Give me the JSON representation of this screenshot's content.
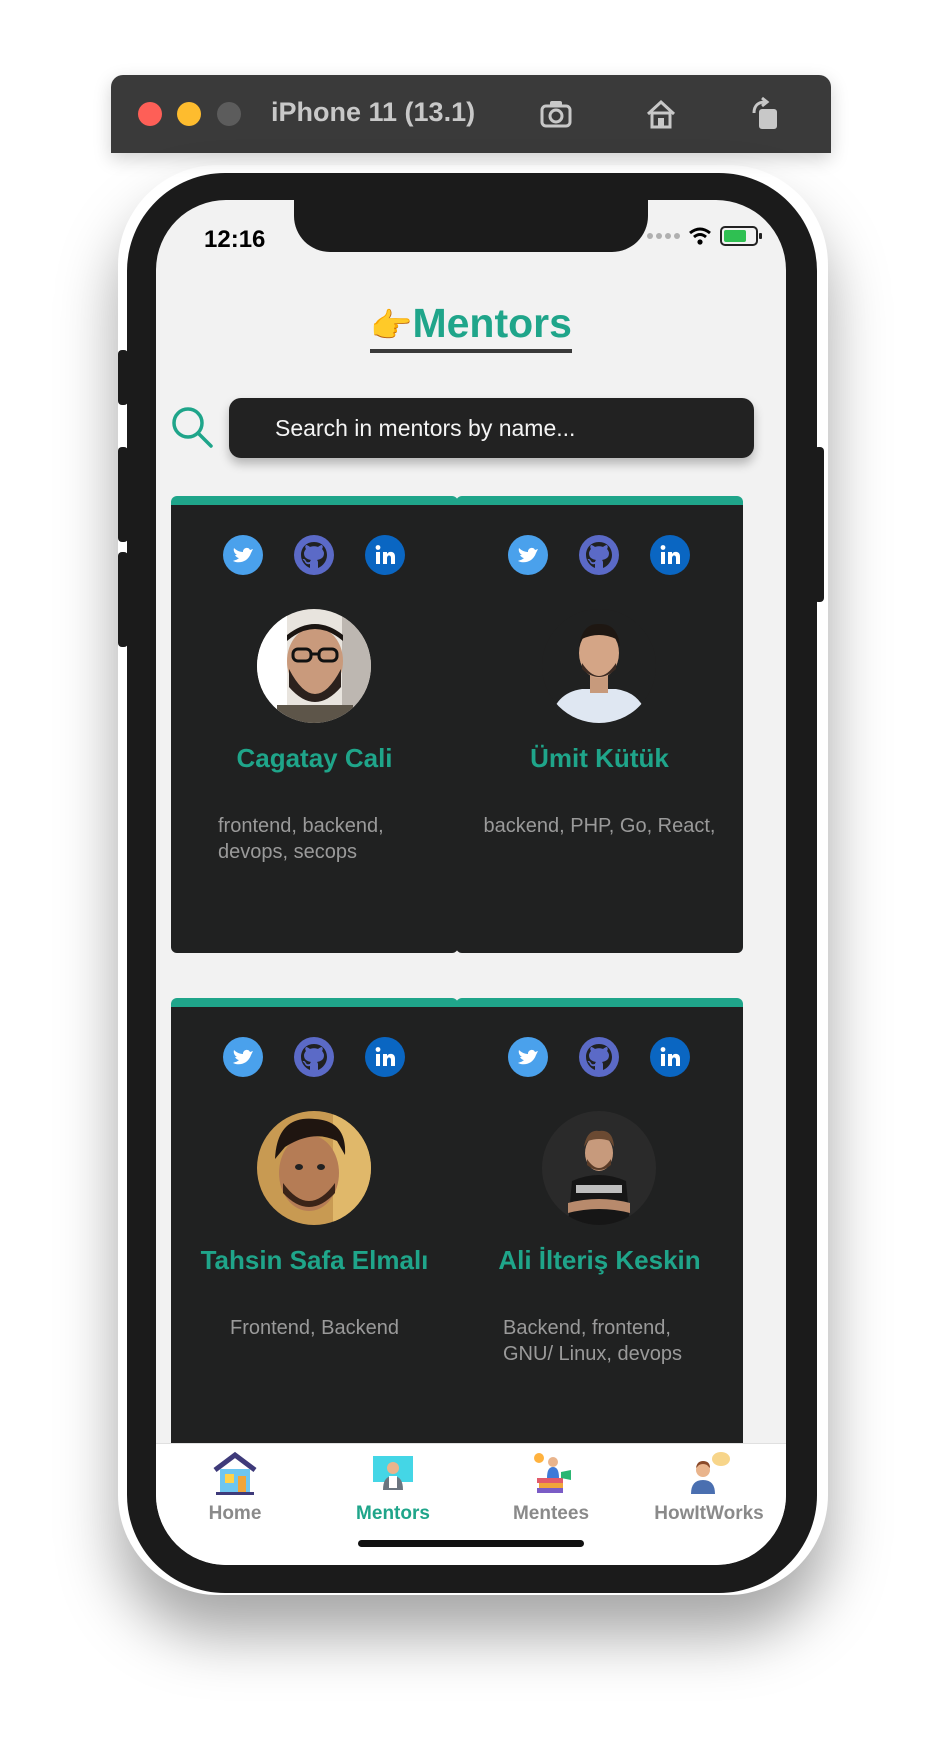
{
  "simulator": {
    "title": "iPhone 11 (13.1)",
    "buttons": [
      "screenshot-icon",
      "home-icon",
      "rotate-icon"
    ]
  },
  "status_bar": {
    "time": "12:16"
  },
  "header": {
    "emoji": "👉",
    "title": "Mentors"
  },
  "search": {
    "placeholder": "Search in mentors by name..."
  },
  "mentors": [
    {
      "name": "Cagatay Cali",
      "skills": "frontend, backend, devops, secops"
    },
    {
      "name": "Ümit Kütük",
      "skills": "backend, PHP, Go, React,"
    },
    {
      "name": "Tahsin Safa Elmalı",
      "skills": "Frontend, Backend"
    },
    {
      "name": "Ali İlteriş Keskin",
      "skills": "Backend, frontend, GNU/ Linux, devops"
    }
  ],
  "tabs": [
    {
      "label": "Home",
      "icon": "house-icon"
    },
    {
      "label": "Mentors",
      "icon": "mentor-board-icon",
      "active": true
    },
    {
      "label": "Mentees",
      "icon": "books-student-icon"
    },
    {
      "label": "HowItWorks",
      "icon": "person-idea-icon"
    }
  ],
  "colors": {
    "accent": "#1fa58a",
    "card_bg": "#202121",
    "twitter": "#4aa1ec",
    "github": "#5b6ac7",
    "linkedin": "#0a66c2"
  }
}
